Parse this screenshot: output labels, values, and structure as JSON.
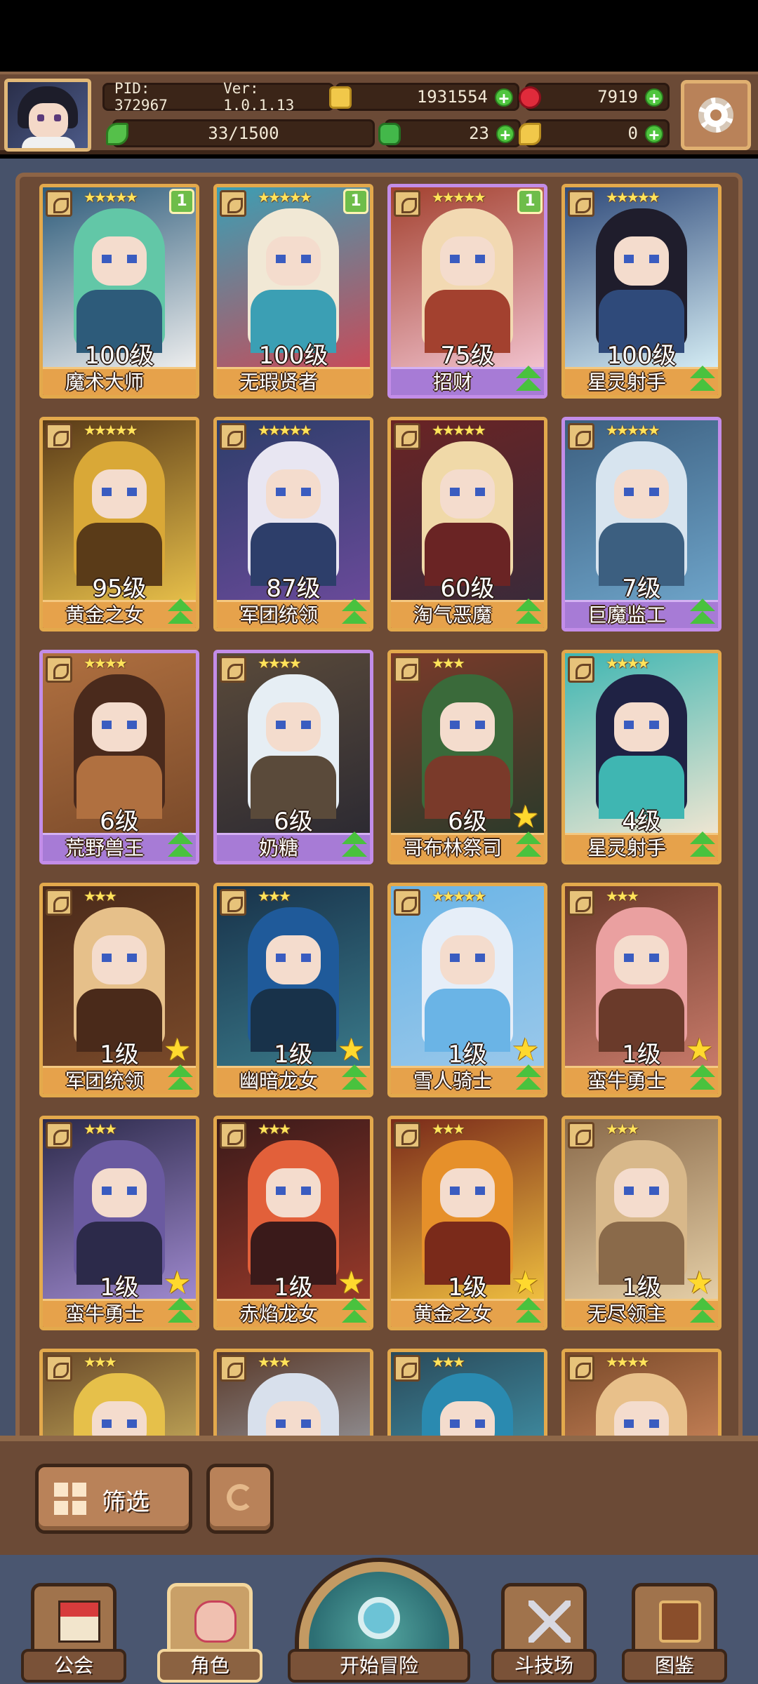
{
  "header": {
    "pid": "PID: 372967",
    "version": "Ver: 1.0.1.13",
    "gold": "1931554",
    "gems": "7919",
    "stamina": "33/1500",
    "clover": "23",
    "keys": "0"
  },
  "heroes": [
    {
      "name": "魔术大师",
      "level": "100级",
      "stars": "★★★★★",
      "count": "1",
      "rarity": "orange",
      "colors": [
        "#62c7a7",
        "#2d5b7a",
        "#f0f0f0"
      ]
    },
    {
      "name": "无瑕贤者",
      "level": "100级",
      "stars": "★★★★★",
      "count": "1",
      "rarity": "orange",
      "colors": [
        "#f1e8d5",
        "#3b9fb4",
        "#c94a58"
      ]
    },
    {
      "name": "招财",
      "level": "75级",
      "stars": "★★★★★",
      "count": "1",
      "rarity": "purple",
      "colors": [
        "#f2d9b2",
        "#a3412f",
        "#f2c3cf"
      ],
      "upgrade": true
    },
    {
      "name": "星灵射手",
      "level": "100级",
      "stars": "★★★★★",
      "rarity": "orange",
      "colors": [
        "#1f1d2c",
        "#2f4a7a",
        "#d6eef5"
      ],
      "upgrade": true
    },
    {
      "name": "黄金之女",
      "level": "95级",
      "stars": "★★★★★",
      "rarity": "orange",
      "colors": [
        "#d9a837",
        "#5a3b18",
        "#e8c04a"
      ],
      "upgrade": true
    },
    {
      "name": "军团统领",
      "level": "87级",
      "stars": "★★★★★",
      "rarity": "orange",
      "colors": [
        "#e8e6f2",
        "#2d3e6a",
        "#6a4a9a"
      ],
      "upgrade": true
    },
    {
      "name": "淘气恶魔",
      "level": "60级",
      "stars": "★★★★★",
      "rarity": "orange",
      "colors": [
        "#f0d9a8",
        "#6a2424",
        "#3a2a3a"
      ],
      "upgrade": true
    },
    {
      "name": "巨魔监工",
      "level": "7级",
      "stars": "★★★★★",
      "rarity": "purple",
      "colors": [
        "#d7e4ef",
        "#3c5f80",
        "#6ea4c9"
      ],
      "upgrade": true
    },
    {
      "name": "荒野兽王",
      "level": "6级",
      "stars": "★★★★",
      "rarity": "purple",
      "colors": [
        "#4a2a1c",
        "#b07040",
        "#7a4a2a"
      ],
      "upgrade": true
    },
    {
      "name": "奶糖",
      "level": "6级",
      "stars": "★★★★",
      "rarity": "purple",
      "colors": [
        "#e6eef4",
        "#5a4a3a",
        "#2c2a32"
      ],
      "upgrade": true
    },
    {
      "name": "哥布林祭司",
      "level": "6级",
      "stars": "★★★",
      "rarity": "orange",
      "colors": [
        "#3a6a3a",
        "#7a3a2a",
        "#2a3a2a"
      ],
      "upgrade": true,
      "star": true
    },
    {
      "name": "星灵射手",
      "level": "4级",
      "stars": "★★★★",
      "rarity": "orange",
      "colors": [
        "#1f2244",
        "#3fb6b2",
        "#f1e6d2"
      ],
      "upgrade": true
    },
    {
      "name": "军团统领",
      "level": "1级",
      "stars": "★★★",
      "rarity": "orange",
      "colors": [
        "#e6c08a",
        "#4a2a1a",
        "#7a4a2a"
      ],
      "upgrade": true,
      "star": true
    },
    {
      "name": "幽暗龙女",
      "level": "1级",
      "stars": "★★★",
      "rarity": "orange",
      "colors": [
        "#1f5a9a",
        "#18324a",
        "#3a7a8a"
      ],
      "upgrade": true,
      "star": true
    },
    {
      "name": "雪人骑士",
      "level": "1级",
      "stars": "★★★★★",
      "rarity": "orange",
      "colors": [
        "#e6eef8",
        "#6ab4e6",
        "#9ac8ea"
      ],
      "upgrade": true,
      "star": true
    },
    {
      "name": "蛮牛勇士",
      "level": "1级",
      "stars": "★★★",
      "rarity": "orange",
      "colors": [
        "#eaa0a0",
        "#6a3a2a",
        "#c87a6a"
      ],
      "upgrade": true,
      "star": true
    },
    {
      "name": "蛮牛勇士",
      "level": "1级",
      "stars": "★★★",
      "rarity": "orange",
      "colors": [
        "#6a5aa0",
        "#2c2a4a",
        "#a08ad0"
      ],
      "upgrade": true,
      "star": true
    },
    {
      "name": "赤焰龙女",
      "level": "1级",
      "stars": "★★★",
      "rarity": "orange",
      "colors": [
        "#e2603a",
        "#3a1a1a",
        "#9a3a2a"
      ],
      "upgrade": true,
      "star": true
    },
    {
      "name": "黄金之女",
      "level": "1级",
      "stars": "★★★",
      "rarity": "orange",
      "colors": [
        "#e6902a",
        "#7a2a1a",
        "#f0c040"
      ],
      "upgrade": true,
      "star": true
    },
    {
      "name": "无尽领主",
      "level": "1级",
      "stars": "★★★",
      "rarity": "orange",
      "colors": [
        "#d8b88a",
        "#8a6a4a",
        "#e6d0a8"
      ],
      "upgrade": true,
      "star": true
    },
    {
      "name": "",
      "level": "",
      "stars": "★★★",
      "rarity": "orange",
      "colors": [
        "#e6c04a",
        "#6a4a2a",
        "#f0d870"
      ]
    },
    {
      "name": "",
      "level": "",
      "stars": "★★★",
      "rarity": "orange",
      "colors": [
        "#d8e0ec",
        "#5a3a2a",
        "#b0c0d0"
      ]
    },
    {
      "name": "",
      "level": "",
      "stars": "★★★",
      "rarity": "orange",
      "colors": [
        "#2a8ab0",
        "#2a4a5a",
        "#4ab0c8"
      ]
    },
    {
      "name": "",
      "level": "",
      "stars": "★★★★",
      "rarity": "orange",
      "colors": [
        "#e8c08a",
        "#7a4a2a",
        "#f0a070"
      ]
    }
  ],
  "filter": {
    "label": "筛选"
  },
  "nav": {
    "guild": "公会",
    "role": "角色",
    "adventure": "开始冒险",
    "arena": "斗技场",
    "codex": "图鉴"
  }
}
